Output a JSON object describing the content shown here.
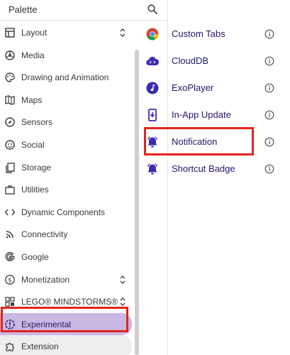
{
  "palette": {
    "title": "Palette",
    "categories": [
      {
        "label": "Layout",
        "icon": "layout-icon",
        "expand": true
      },
      {
        "label": "Media",
        "icon": "media-icon",
        "expand": false
      },
      {
        "label": "Drawing and Animation",
        "icon": "palette-icon",
        "expand": false
      },
      {
        "label": "Maps",
        "icon": "map-icon",
        "expand": false
      },
      {
        "label": "Sensors",
        "icon": "compass-icon",
        "expand": false
      },
      {
        "label": "Social",
        "icon": "social-icon",
        "expand": false
      },
      {
        "label": "Storage",
        "icon": "storage-icon",
        "expand": false
      },
      {
        "label": "Utilities",
        "icon": "briefcase-icon",
        "expand": false
      },
      {
        "label": "Dynamic Components",
        "icon": "code-icon",
        "expand": false
      },
      {
        "label": "Connectivity",
        "icon": "wifi-icon",
        "expand": false
      },
      {
        "label": "Google",
        "icon": "google-icon",
        "expand": false
      },
      {
        "label": "Monetization",
        "icon": "dollar-icon",
        "expand": true
      },
      {
        "label": "LEGO® MINDSTORMS®",
        "icon": "lego-icon",
        "expand": true
      },
      {
        "label": "Experimental",
        "icon": "experimental-icon",
        "expand": false
      },
      {
        "label": "Extension",
        "icon": "puzzle-icon",
        "expand": false
      }
    ]
  },
  "components": [
    {
      "label": "Custom Tabs",
      "icon": "chrome-icon"
    },
    {
      "label": "CloudDB",
      "icon": "cloud-db-icon"
    },
    {
      "label": "ExoPlayer",
      "icon": "music-icon"
    },
    {
      "label": "In-App Update",
      "icon": "phone-update-icon"
    },
    {
      "label": "Notification",
      "icon": "bell-icon"
    },
    {
      "label": "Shortcut Badge",
      "icon": "bell-icon"
    }
  ],
  "colors": {
    "selected_bg": "#c9b8e4",
    "highlight": "#e3241b",
    "component_text": "#1f1a6a",
    "icon_purple": "#3b2bb0"
  }
}
